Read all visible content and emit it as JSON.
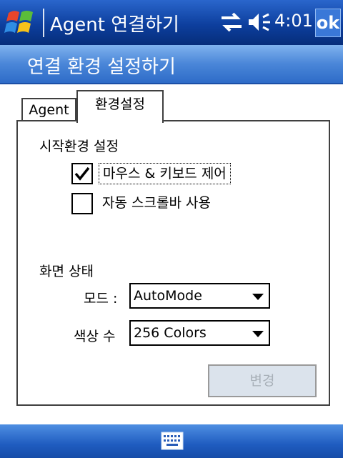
{
  "titlebar": {
    "title": "Agent 연결하기",
    "time": "4:01",
    "ok_label": "ok",
    "icons": [
      "windows-start-icon",
      "connectivity-icon",
      "volume-icon"
    ]
  },
  "header": {
    "title": "연결 환경 설정하기"
  },
  "tabs": [
    {
      "label": "Agent",
      "selected": false
    },
    {
      "label": "환경설정",
      "selected": true
    }
  ],
  "start_settings": {
    "title": "시작환경 설정",
    "options": [
      {
        "label": "마우스 & 키보드 제어",
        "checked": true
      },
      {
        "label": "자동 스크롤바 사용",
        "checked": false
      }
    ]
  },
  "screen_state": {
    "title": "화면 상태",
    "mode_label": "모드 :",
    "mode_value": "AutoMode",
    "colors_label": "색상 수",
    "colors_value": "256 Colors"
  },
  "change_button": {
    "label": "변경",
    "enabled": false
  },
  "bottombar": {
    "icon": "keyboard-icon"
  },
  "colors": {
    "titlebar": "#0d3f9e",
    "header": "#4a86d8",
    "button_disabled_text": "#a8b0b8"
  }
}
